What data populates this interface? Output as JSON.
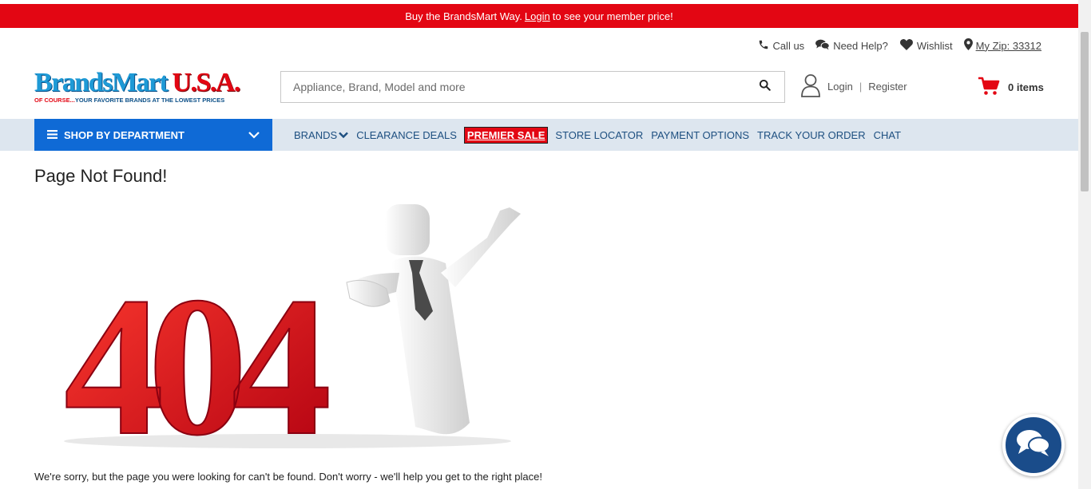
{
  "promo": {
    "before": "Buy the BrandsMart Way.",
    "link": "Login",
    "after": "to see your member price!"
  },
  "utility": {
    "call": "Call us",
    "help": "Need Help?",
    "wishlist": "Wishlist",
    "zip": "My Zip: 33312"
  },
  "logo": {
    "name": "BrandsMart",
    "usa": "U.S.A.",
    "tagline_red": "OF COURSE...",
    "tagline_blue": "YOUR FAVORITE BRANDS AT THE LOWEST PRICES"
  },
  "search": {
    "placeholder": "Appliance, Brand, Model and more"
  },
  "account": {
    "login": "Login",
    "separator": "|",
    "register": "Register"
  },
  "cart": {
    "count_label": "0 items"
  },
  "nav": {
    "department": "SHOP BY DEPARTMENT",
    "links": [
      "BRANDS",
      "CLEARANCE DEALS",
      "PREMIER SALE",
      "STORE LOCATOR",
      "PAYMENT OPTIONS",
      "TRACK YOUR ORDER",
      "CHAT"
    ]
  },
  "main": {
    "title": "Page Not Found!",
    "illustration_text": "404",
    "message": "We're sorry, but the page you were looking for can't be found. Don't worry - we'll help you get to the right place!"
  },
  "colors": {
    "promo_red": "#e30613",
    "nav_blue": "#0f6ad6",
    "nav_bg": "#dde6ef",
    "link_blue": "#1d4f80",
    "chat_blue": "#1a4c8a"
  },
  "icons": {
    "call": "phone-icon",
    "help": "chat-bubbles-icon",
    "wishlist": "heart-icon",
    "zip": "map-pin-icon",
    "search": "search-icon",
    "account": "user-icon",
    "cart": "cart-icon",
    "department": "hamburger-icon",
    "department_toggle": "chevron-down-icon",
    "chat": "chat-icon"
  }
}
